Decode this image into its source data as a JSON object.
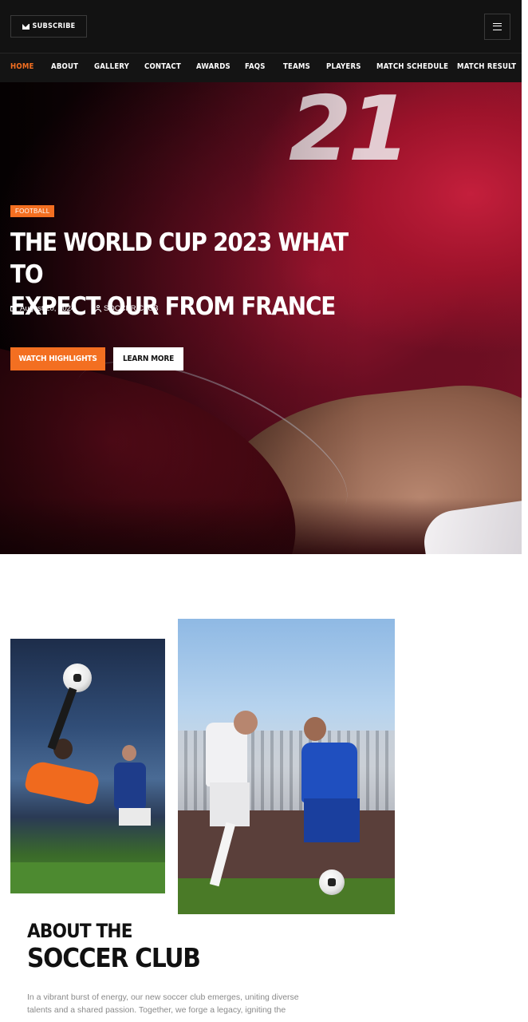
{
  "header": {
    "subscribe_label": "SUBSCRIBE",
    "subscribe_icon": "envelope-icon",
    "menu_icon": "hamburger-menu-icon"
  },
  "nav": {
    "items": [
      {
        "label": "HOME",
        "active": true
      },
      {
        "label": "ABOUT"
      },
      {
        "label": "GALLERY"
      },
      {
        "label": "CONTACT"
      },
      {
        "label": "AWARDS"
      },
      {
        "label": "FAQS"
      },
      {
        "label": "TEAMS"
      },
      {
        "label": "PLAYERS"
      },
      {
        "label": "MATCH SCHEDULE"
      },
      {
        "label": "MATCH RESULT"
      }
    ]
  },
  "hero": {
    "tag": "FOOTBALL",
    "jersey_number": "21",
    "title_line1": "THE WORLD CUP 2023 WHAT TO",
    "title_line2": "EXPECT OUR FROM FRANCE",
    "date": "August 20, 2024",
    "author": "SOCCER CLUB",
    "watch_label": "WATCH HIGHLIGHTS",
    "learn_label": "LEARN MORE"
  },
  "about": {
    "title_line1": "ABOUT THE",
    "title_line2": "SOCCER CLUB",
    "text": "In a vibrant burst of energy, our new soccer club emerges, uniting diverse talents and a shared passion. Together, we forge a legacy, igniting the"
  },
  "colors": {
    "accent": "#f36f21",
    "header_bg": "#121212",
    "text_dark": "#111111",
    "text_muted": "#8a8a8a"
  }
}
